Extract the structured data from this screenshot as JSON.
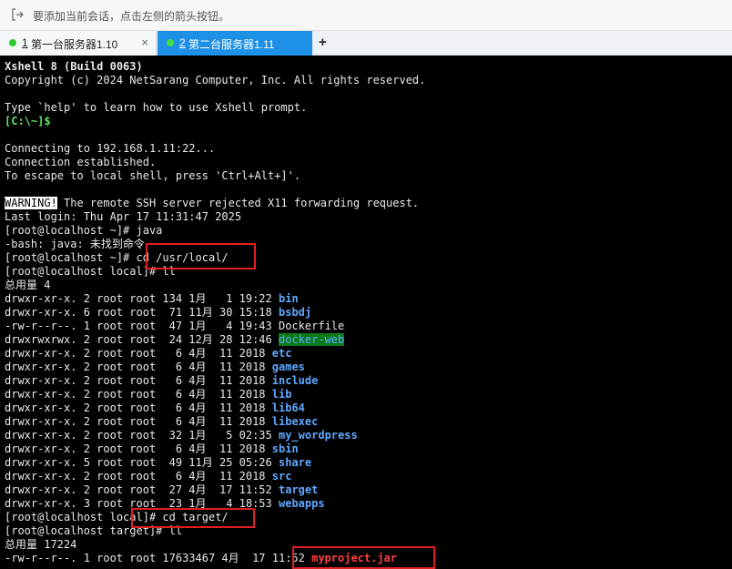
{
  "hint": {
    "text": "要添加当前会话，点击左侧的箭头按钮。",
    "icon": "add-session-icon"
  },
  "tabs": [
    {
      "num": "1",
      "label": "第一台服务器1.10",
      "close": "×",
      "active": false
    },
    {
      "num": "2",
      "label": "第二台服务器1.11",
      "close": "",
      "active": true
    }
  ],
  "new_tab": "+",
  "terminal": {
    "banner_title": "Xshell 8 (Build 0063)",
    "banner_copyright": "Copyright (c) 2024 NetSarang Computer, Inc. All rights reserved.",
    "help_line": "Type `help' to learn how to use Xshell prompt.",
    "local_prompt": "[C:\\~]$",
    "connecting": "Connecting to 192.168.1.11:22...",
    "established": "Connection established.",
    "escape": "To escape to local shell, press 'Ctrl+Alt+]'.",
    "warning_tag": "WARNING!",
    "warning_msg": " The remote SSH server rejected X11 forwarding request.",
    "last_login": "Last login: Thu Apr 17 11:31:47 2025",
    "cmd1": "[root@localhost ~]# java",
    "bash_err": "-bash: java: 未找到命令",
    "cmd2": "[root@localhost ~]# cd /usr/local/",
    "cmd3": "[root@localhost local]# ll",
    "total1": "总用量 4",
    "listing": [
      {
        "meta": "drwxr-xr-x. 2 root root 134 1月   1 19:22 ",
        "name": "bin",
        "style": "dir"
      },
      {
        "meta": "drwxr-xr-x. 6 root root  71 11月 30 15:18 ",
        "name": "bsbdj",
        "style": "dir"
      },
      {
        "meta": "-rw-r--r--. 1 root root  47 1月   4 19:43 ",
        "name": "Dockerfile",
        "style": "plain"
      },
      {
        "meta": "drwxrwxrwx. 2 root root  24 12月 28 12:46 ",
        "name": "docker-web",
        "style": "dhl"
      },
      {
        "meta": "drwxr-xr-x. 2 root root   6 4月  11 2018 ",
        "name": "etc",
        "style": "dir"
      },
      {
        "meta": "drwxr-xr-x. 2 root root   6 4月  11 2018 ",
        "name": "games",
        "style": "dir"
      },
      {
        "meta": "drwxr-xr-x. 2 root root   6 4月  11 2018 ",
        "name": "include",
        "style": "dir"
      },
      {
        "meta": "drwxr-xr-x. 2 root root   6 4月  11 2018 ",
        "name": "lib",
        "style": "dir"
      },
      {
        "meta": "drwxr-xr-x. 2 root root   6 4月  11 2018 ",
        "name": "lib64",
        "style": "dir"
      },
      {
        "meta": "drwxr-xr-x. 2 root root   6 4月  11 2018 ",
        "name": "libexec",
        "style": "dir"
      },
      {
        "meta": "drwxr-xr-x. 2 root root  32 1月   5 02:35 ",
        "name": "my_wordpress",
        "style": "dir"
      },
      {
        "meta": "drwxr-xr-x. 2 root root   6 4月  11 2018 ",
        "name": "sbin",
        "style": "dir"
      },
      {
        "meta": "drwxr-xr-x. 5 root root  49 11月 25 05:26 ",
        "name": "share",
        "style": "dir"
      },
      {
        "meta": "drwxr-xr-x. 2 root root   6 4月  11 2018 ",
        "name": "src",
        "style": "dir"
      },
      {
        "meta": "drwxr-xr-x. 2 root root  27 4月  17 11:52 ",
        "name": "target",
        "style": "dir"
      },
      {
        "meta": "drwxr-xr-x. 3 root root  23 1月   4 18:53 ",
        "name": "webapps",
        "style": "dir"
      }
    ],
    "cmd4": "[root@localhost local]# cd target/",
    "cmd5": "[root@localhost target]# ll",
    "total2": "总用量 17224",
    "jar_meta": "-rw-r--r--. 1 root root 17633467 4月  17 11:52 ",
    "jar_name": "myproject.jar",
    "colors": {
      "dir": "#5fa8ff",
      "prompt": "#5fe35f",
      "highlight": "#e02020",
      "docker_bg": "#0a7b18",
      "active_tab": "#1e90e6"
    }
  }
}
